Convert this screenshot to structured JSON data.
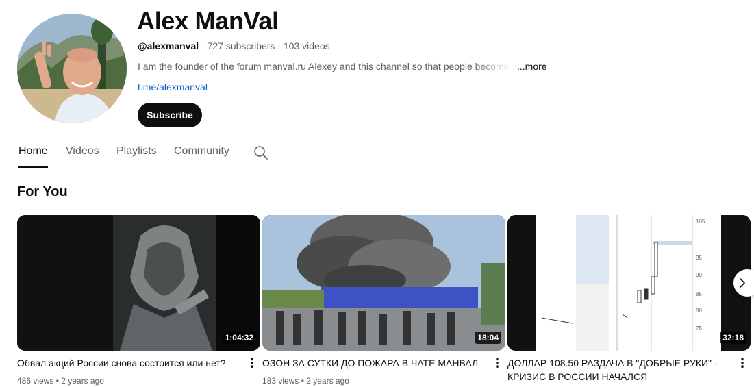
{
  "channel": {
    "name": "Alex ManVal",
    "handle": "@alexmanval",
    "subscribers": "727 subscribers",
    "videos_count": "103 videos",
    "sep1": " · ",
    "sep2": " · ",
    "description": "I am the founder of the forum manval.ru Alexey and this channel so that people become",
    "more_label": "...more",
    "link": "t.me/alexmanval",
    "subscribe_label": "Subscribe"
  },
  "tabs": [
    {
      "label": "Home",
      "active": true
    },
    {
      "label": "Videos",
      "active": false
    },
    {
      "label": "Playlists",
      "active": false
    },
    {
      "label": "Community",
      "active": false
    }
  ],
  "tab_search_icon": "search-icon",
  "section": {
    "title": "For You"
  },
  "videos": [
    {
      "title": "Обвал акций России снова состоится или нет?",
      "duration": "1:04:32",
      "views": "486 views",
      "age": "2 years ago",
      "sep": " • "
    },
    {
      "title": "ОЗОН ЗА СУТКИ ДО ПОЖАРА В ЧАТЕ МАНВАЛ",
      "duration": "18:04",
      "views": "183 views",
      "age": "2 years ago",
      "sep": " • "
    },
    {
      "title": "ДОЛЛАР 108.50 РАЗДАЧА В \"ДОБРЫЕ РУКИ\" - КРИЗИС В РОССИИ НАЧАЛСЯ",
      "duration": "32:18",
      "views": "",
      "age": "",
      "sep": ""
    }
  ],
  "next_icon": "chevron-right-icon",
  "kebab_icon": "more-vert-icon",
  "colors": {
    "link": "#065fd4",
    "subscribe_bg": "#0f0f0f",
    "secondary_text": "#606060"
  }
}
